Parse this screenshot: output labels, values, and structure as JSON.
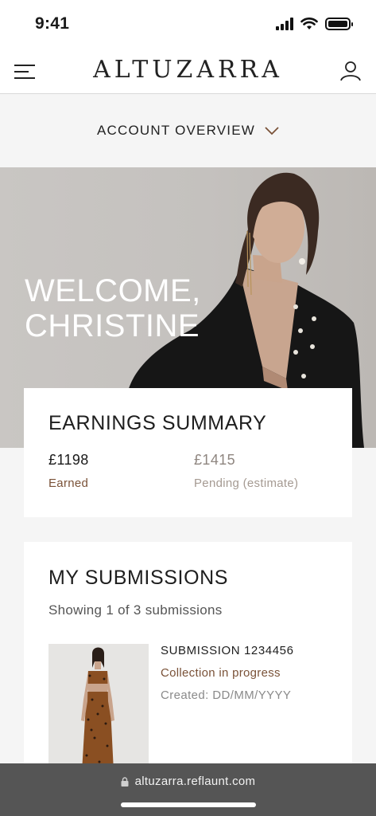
{
  "status_bar": {
    "time": "9:41",
    "icons": [
      "signal-icon",
      "wifi-icon",
      "battery-icon"
    ]
  },
  "header": {
    "brand": "ALTUZARRA",
    "menu_icon": "hamburger-menu-icon",
    "account_icon": "user-icon"
  },
  "account_overview": {
    "label": "ACCOUNT OVERVIEW",
    "icon": "chevron-down-icon"
  },
  "hero": {
    "line1": "WELCOME,",
    "line2": "CHRISTINE"
  },
  "earnings": {
    "title": "EARNINGS SUMMARY",
    "earned": {
      "amount": "£1198",
      "label": "Earned"
    },
    "pending": {
      "amount": "£1415",
      "label": "Pending (estimate)"
    }
  },
  "submissions": {
    "title": "MY SUBMISSIONS",
    "showing": "Showing 1 of 3 submissions",
    "items": [
      {
        "id": "SUBMISSION 1234456",
        "status": "Collection in progress",
        "created": "Created: DD/MM/YYYY"
      }
    ]
  },
  "browser": {
    "url": "altuzarra.reflaunt.com",
    "lock_icon": "lock-icon"
  },
  "colors": {
    "accent_brown": "#7a5238",
    "pending_gray": "#9a8f88",
    "url_bar": "#555555"
  }
}
